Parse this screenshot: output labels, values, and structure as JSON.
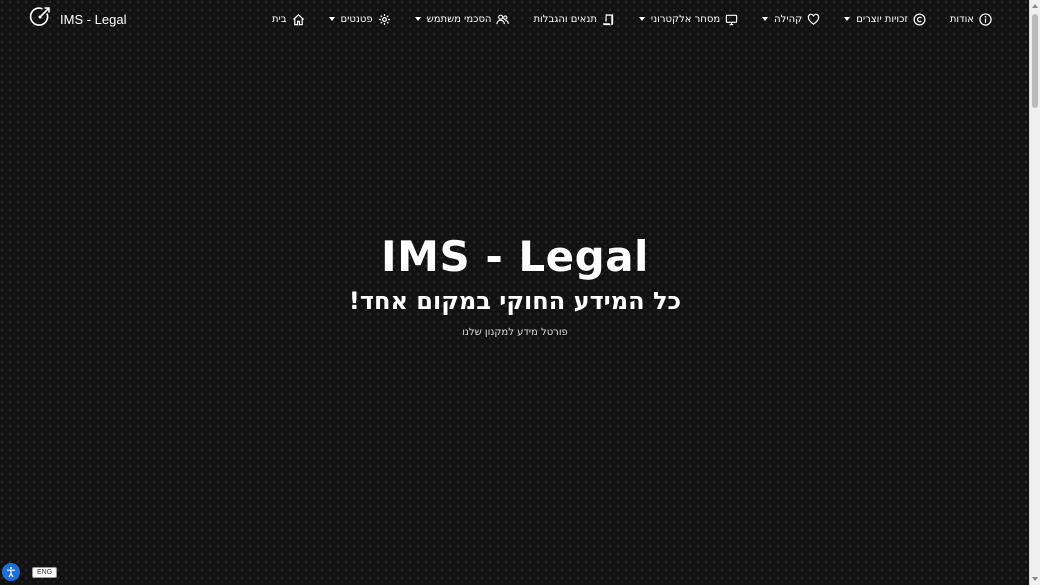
{
  "brand": {
    "name": "IMS - Legal"
  },
  "nav": {
    "items": [
      {
        "label": "אודות",
        "icon": "info-icon",
        "dropdown": false
      },
      {
        "label": "זכויות יוצרים",
        "icon": "copyright-icon",
        "dropdown": true
      },
      {
        "label": "קהילה",
        "icon": "heart-icon",
        "dropdown": true
      },
      {
        "label": "מסחר אלקטרוני",
        "icon": "laptop-icon",
        "dropdown": true
      },
      {
        "label": "תנאים והגבלות",
        "icon": "scroll-icon",
        "dropdown": false
      },
      {
        "label": "הסכמי משתמש",
        "icon": "users-icon",
        "dropdown": true
      },
      {
        "label": "פטנטים",
        "icon": "gear-icon",
        "dropdown": true
      },
      {
        "label": "בית",
        "icon": "home-icon",
        "dropdown": false
      }
    ]
  },
  "hero": {
    "title": "IMS - Legal",
    "subtitle": "כל המידע החוקי במקום אחד!",
    "tagline": "פורטל מידע למקנון שלנו"
  },
  "accessibility": {
    "language_badge": "ENG"
  },
  "colors": {
    "background": "#111111",
    "text": "#ffffff",
    "accessibility_button": "#1e6fd9"
  }
}
